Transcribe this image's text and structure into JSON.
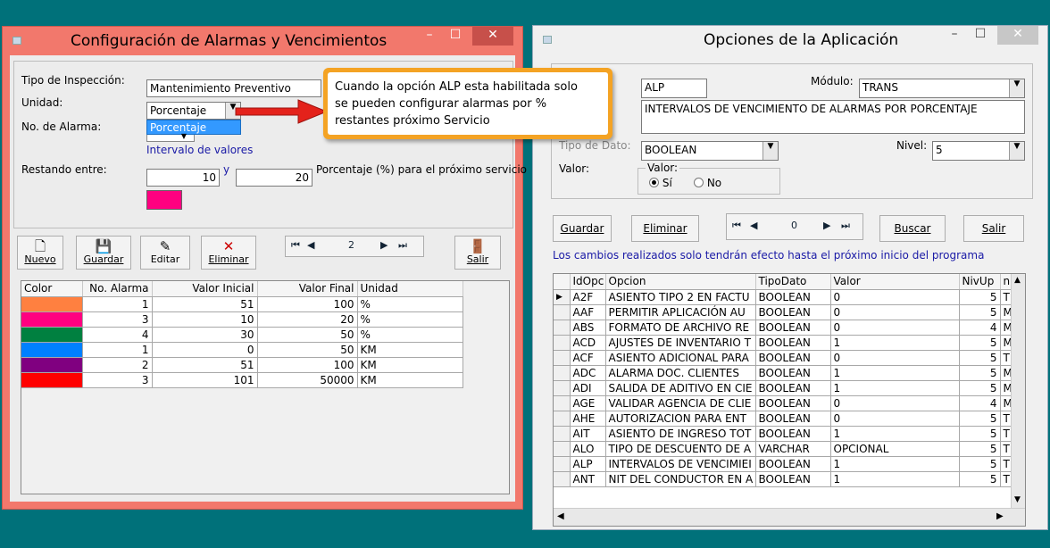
{
  "win1": {
    "title": "Configuración de Alarmas y Vencimientos",
    "caption": {
      "min": "–",
      "max": "☐",
      "close": "✕"
    },
    "tipo_label": "Tipo de Inspección:",
    "tipo_value": "Mantenimiento Preventivo",
    "unidad_label": "Unidad:",
    "unidad_value": "Porcentaje",
    "unidad_dropdown_option": "Porcentaje",
    "alarma_label": "No. de Alarma:",
    "intervalo_label": "Intervalo de valores",
    "restando_label": "Restando entre:",
    "from_value": "10",
    "y_label": "y",
    "to_value": "20",
    "porcentaje_label": "Porcentaje (%) para el próximo servicio",
    "selected_color": "#ff0080",
    "toolbar": {
      "nuevo": "Nuevo",
      "guardar": "Guardar",
      "editar": "Editar",
      "eliminar": "Eliminar",
      "salir": "Salir",
      "nav_value": "2"
    },
    "grid": {
      "headers": [
        "Color",
        "No. Alarma",
        "Valor Inicial",
        "Valor Final",
        "Unidad"
      ],
      "rows": [
        {
          "color": "#ff8040",
          "alarma": "1",
          "inicial": "51",
          "final": "100",
          "unidad": "%"
        },
        {
          "color": "#ff0080",
          "alarma": "3",
          "inicial": "10",
          "final": "20",
          "unidad": "%"
        },
        {
          "color": "#008040",
          "alarma": "4",
          "inicial": "30",
          "final": "50",
          "unidad": "%"
        },
        {
          "color": "#0080ff",
          "alarma": "1",
          "inicial": "0",
          "final": "50",
          "unidad": "KM"
        },
        {
          "color": "#800080",
          "alarma": "2",
          "inicial": "51",
          "final": "100",
          "unidad": "KM"
        },
        {
          "color": "#ff0000",
          "alarma": "3",
          "inicial": "101",
          "final": "50000",
          "unidad": "KM"
        }
      ]
    }
  },
  "callout": {
    "line1": "Cuando la opción ALP esta habilitada solo",
    "line2": "se pueden configurar alarmas por %",
    "line3": "restantes próximo Servicio"
  },
  "win2": {
    "title": "Opciones de la Aplicación",
    "caption": {
      "min": "–",
      "max": "☐",
      "close": "✕"
    },
    "code_value": "ALP",
    "modulo_label": "Módulo:",
    "modulo_value": "TRANS",
    "desc_value": "INTERVALOS DE VENCIMIENTO DE ALARMAS POR PORCENTAJE",
    "tipo_label_partial": "Tipo de Dato:",
    "tipo_value": "BOOLEAN",
    "nivel_label": "Nivel:",
    "nivel_value": "5",
    "valor_label": "Valor:",
    "valor_group_label": "Valor:",
    "radio_si": "Sí",
    "radio_no": "No",
    "buttons": {
      "guardar": "Guardar",
      "eliminar": "Eliminar",
      "buscar": "Buscar",
      "salir": "Salir",
      "nav_value": "0"
    },
    "notice": "Los cambios realizados solo tendrán efecto hasta el próximo inicio del programa",
    "grid": {
      "headers": [
        "IdOpc",
        "Opcion",
        "TipoDato",
        "Valor",
        "NivUp",
        "nMod"
      ],
      "rows": [
        {
          "id": "A2F",
          "opcion": "ASIENTO TIPO 2 EN FACTU",
          "tipo": "BOOLEAN",
          "valor": "0",
          "niv": "5",
          "mod": "TRAN"
        },
        {
          "id": "AAF",
          "opcion": "PERMITIR APLICACIÓN AU",
          "tipo": "BOOLEAN",
          "valor": "0",
          "niv": "5",
          "mod": "MAIN"
        },
        {
          "id": "ABS",
          "opcion": "FORMATO DE ARCHIVO RE",
          "tipo": "BOOLEAN",
          "valor": "0",
          "niv": "4",
          "mod": "MAIN"
        },
        {
          "id": "ACD",
          "opcion": "AJUSTES DE INVENTARIO T",
          "tipo": "BOOLEAN",
          "valor": "1",
          "niv": "5",
          "mod": "MAIN"
        },
        {
          "id": "ACF",
          "opcion": "ASIENTO ADICIONAL PARA",
          "tipo": "BOOLEAN",
          "valor": "0",
          "niv": "5",
          "mod": "TRAN"
        },
        {
          "id": "ADC",
          "opcion": "ALARMA DOC. CLIENTES",
          "tipo": "BOOLEAN",
          "valor": "1",
          "niv": "5",
          "mod": "MAIN"
        },
        {
          "id": "ADI",
          "opcion": "SALIDA DE ADITIVO EN CIE",
          "tipo": "BOOLEAN",
          "valor": "1",
          "niv": "5",
          "mod": "MAIN"
        },
        {
          "id": "AGE",
          "opcion": "VALIDAR AGENCIA DE CLIE",
          "tipo": "BOOLEAN",
          "valor": "0",
          "niv": "4",
          "mod": "MAIN"
        },
        {
          "id": "AHE",
          "opcion": "AUTORIZACION PARA ENT",
          "tipo": "BOOLEAN",
          "valor": "0",
          "niv": "5",
          "mod": "TRAN"
        },
        {
          "id": "AIT",
          "opcion": "ASIENTO DE INGRESO TOT",
          "tipo": "BOOLEAN",
          "valor": "1",
          "niv": "5",
          "mod": "TRAN"
        },
        {
          "id": "ALO",
          "opcion": "TIPO DE DESCUENTO DE A",
          "tipo": "VARCHAR",
          "valor": "OPCIONAL",
          "niv": "5",
          "mod": "TRAN"
        },
        {
          "id": "ALP",
          "opcion": "INTERVALOS DE VENCIMIEI",
          "tipo": "BOOLEAN",
          "valor": "1",
          "niv": "5",
          "mod": "TRAN"
        },
        {
          "id": "ANT",
          "opcion": "NIT DEL CONDUCTOR EN A",
          "tipo": "BOOLEAN",
          "valor": "1",
          "niv": "5",
          "mod": "TRAN"
        }
      ]
    }
  }
}
